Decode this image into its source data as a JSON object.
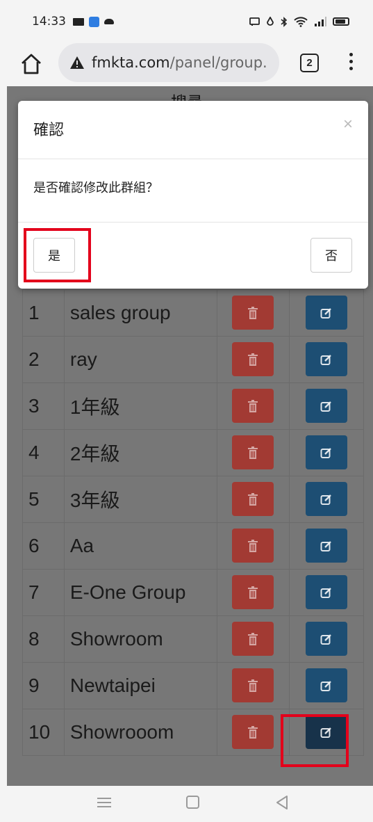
{
  "status_bar": {
    "time": "14:33",
    "left_icons": [
      "mail-icon",
      "app-icon",
      "cloud-icon"
    ],
    "right_icons": [
      "cast-icon",
      "drop-icon",
      "bluetooth-icon",
      "wifi-icon",
      "signal-icon",
      "battery-icon"
    ]
  },
  "browser": {
    "url_host": "fmkta.com",
    "url_path": "/panel/group.",
    "tab_count": "2",
    "security_icon": "warning-triangle-icon"
  },
  "page": {
    "header_partial": "搜尋",
    "rows": [
      {
        "num": "1",
        "name": "sales group"
      },
      {
        "num": "2",
        "name": "ray"
      },
      {
        "num": "3",
        "name": "1年級"
      },
      {
        "num": "4",
        "name": "2年級"
      },
      {
        "num": "5",
        "name": "3年級"
      },
      {
        "num": "6",
        "name": "Aa"
      },
      {
        "num": "7",
        "name": "E-One Group"
      },
      {
        "num": "8",
        "name": "Showroom"
      },
      {
        "num": "9",
        "name": "Newtaipei"
      },
      {
        "num": "10",
        "name": "Showrooom"
      }
    ],
    "delete_icon": "trash-icon",
    "edit_icon": "edit-icon"
  },
  "modal": {
    "title": "確認",
    "close_label": "×",
    "message": "是否確認修改此群組？",
    "yes_label": "是",
    "no_label": "否"
  },
  "colors": {
    "delete_button": "#a23a33",
    "edit_button": "#1d4e73",
    "highlight": "#e3001b"
  }
}
